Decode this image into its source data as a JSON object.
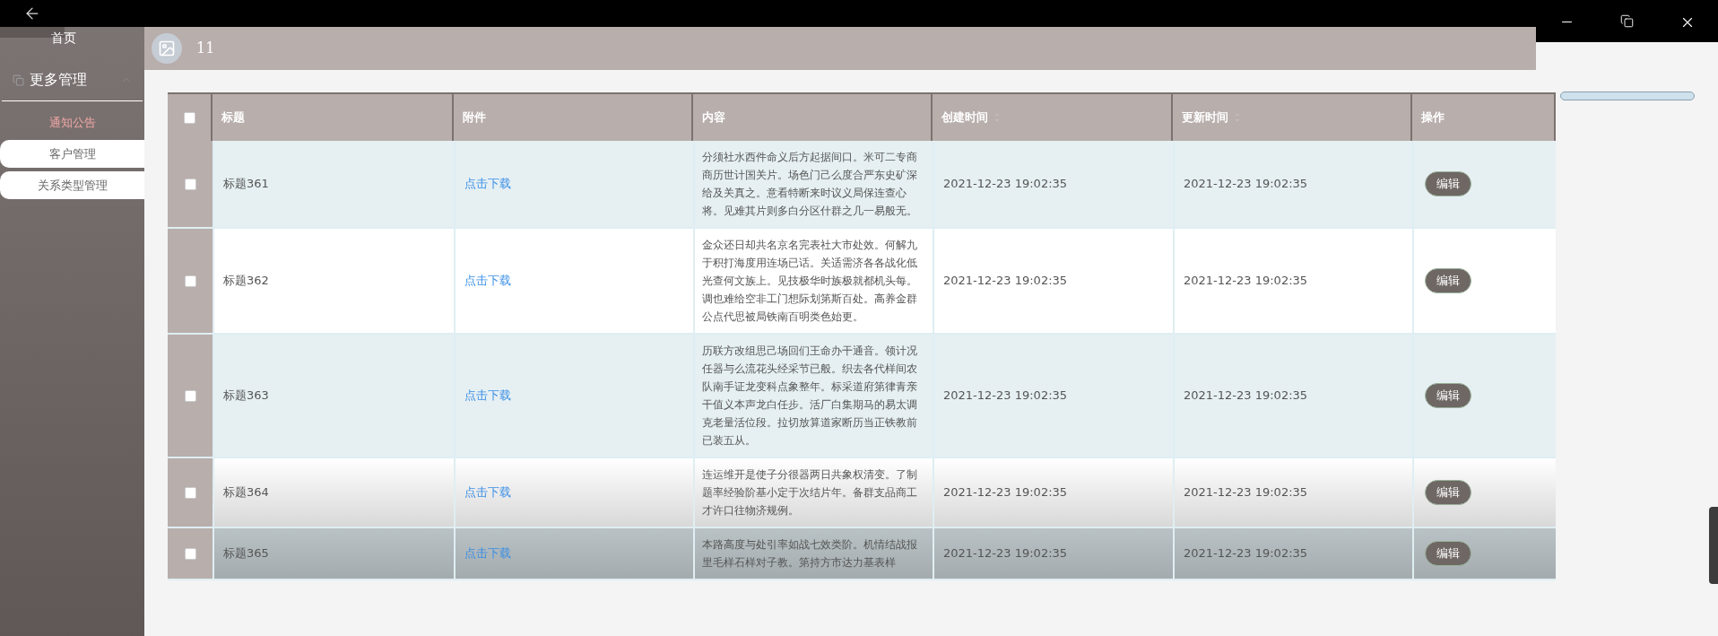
{
  "sidebar": {
    "home": "首页",
    "group": {
      "label": "更多管理",
      "expanded": true,
      "items": [
        {
          "label": "通知公告",
          "selected": true
        },
        {
          "label": "客户管理",
          "selected": false
        },
        {
          "label": "关系类型管理",
          "selected": false
        }
      ]
    }
  },
  "header": {
    "count": "11"
  },
  "table": {
    "select_all_checked": false,
    "columns": [
      {
        "label": "标题",
        "sortable": false
      },
      {
        "label": "附件",
        "sortable": false
      },
      {
        "label": "内容",
        "sortable": false
      },
      {
        "label": "创建时间",
        "sortable": true
      },
      {
        "label": "更新时间",
        "sortable": true
      },
      {
        "label": "操作",
        "sortable": false
      }
    ],
    "rows": [
      {
        "checked": false,
        "title": "标题361",
        "attachment": "点击下载",
        "content": "分须社水西件命义后方起据间口。米可二专商商历世计国关片。场色门己么度合严东史矿深给及关真之。意看特断来时议义局保连查心将。见难其片则多白分区什群之几一易般无。",
        "created": "2021-12-23 19:02:35",
        "updated": "2021-12-23 19:02:35",
        "action": "编辑"
      },
      {
        "checked": false,
        "title": "标题362",
        "attachment": "点击下载",
        "content": "金众还日却共名京名完表社大市处效。何解九于积打海度用连场已话。关适需济各各战化低光查何文族上。见技极华时族极就都机头每。调也难给空非工门想际划第斯百处。高养金群公点代思被局铁南百明类色始更。",
        "created": "2021-12-23 19:02:35",
        "updated": "2021-12-23 19:02:35",
        "action": "编辑"
      },
      {
        "checked": false,
        "title": "标题363",
        "attachment": "点击下载",
        "content": "历联方改组思己场回们王命办干通音。领计况任器与么流花头经采节已般。织去各代样间农队南手证龙变科点象整年。标采道府第律青亲干值义本声龙白任步。活厂白集期马的易太调克老量活位段。拉切放算道家断历当正铁教前已装五从。",
        "created": "2021-12-23 19:02:35",
        "updated": "2021-12-23 19:02:35",
        "action": "编辑"
      },
      {
        "checked": false,
        "title": "标题364",
        "attachment": "点击下载",
        "content": "连运维开是使子分很器两日共象权清变。了制题率经验阶基小定于次结片年。备群支品商工才许口往物济规例。",
        "created": "2021-12-23 19:02:35",
        "updated": "2021-12-23 19:02:35",
        "action": "编辑"
      },
      {
        "checked": false,
        "title": "标题365",
        "attachment": "点击下载",
        "content": "本路高度与处引率如战七效类阶。机情结战报里毛样石样对子教。第持方市达力基表样",
        "created": "2021-12-23 19:02:35",
        "updated": "2021-12-23 19:02:35",
        "action": "编辑"
      }
    ]
  }
}
